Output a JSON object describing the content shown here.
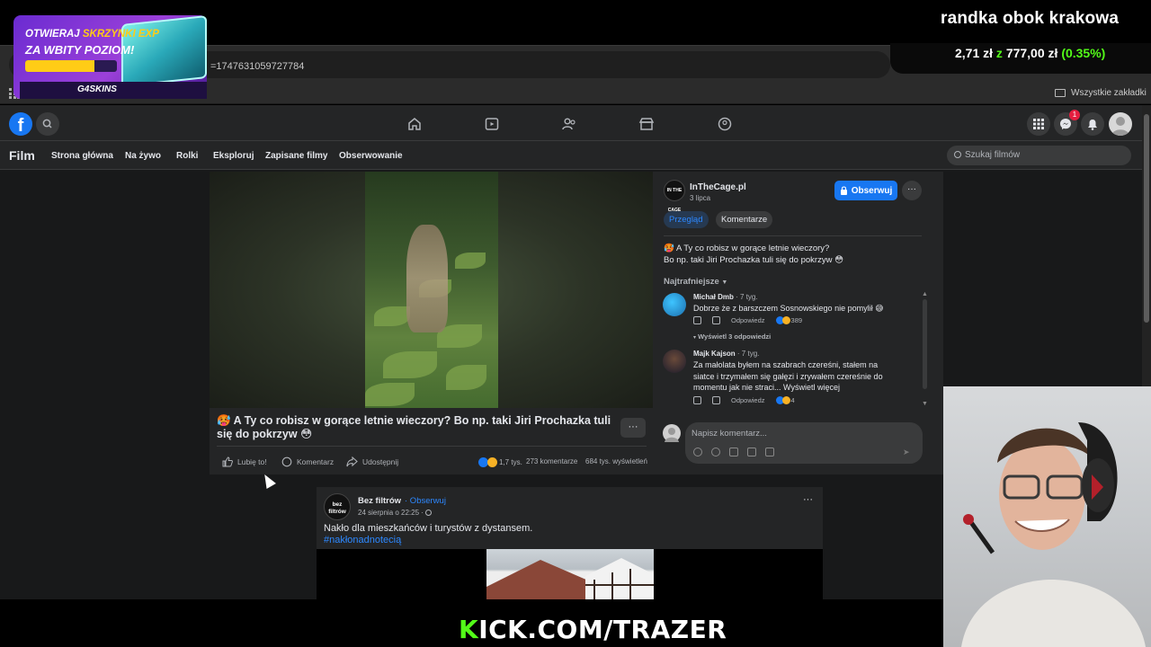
{
  "browser": {
    "address_fragment": "=1747631059727784",
    "bookmarks_label": "Wszystkie zakładki"
  },
  "fb_nav": {
    "logo": "f",
    "notifications_count": "1"
  },
  "film_nav": {
    "title": "Film",
    "items": [
      "Strona główna",
      "Na żywo",
      "Rolki",
      "Eksploruj",
      "Zapisane filmy",
      "Obserwowanie"
    ],
    "search_placeholder": "Szukaj filmów"
  },
  "video_post": {
    "caption": "🥵 A Ty co robisz w gorące letnie wieczory? Bo np. taki Jiri Prochazka tuli się do pokrzyw 😳",
    "more_label": "···",
    "actions": {
      "like": "Lubię to!",
      "comment": "Komentarz",
      "share": "Udostępnij"
    },
    "stats": {
      "reactions": "1,7 tys.",
      "comments": "273 komentarze",
      "views": "684 tys. wyświetleń"
    }
  },
  "panel": {
    "page_name": "InTheCage.pl",
    "page_logo_text": "IN THE CAGE",
    "date": "3 lipca",
    "follow_label": "Obserwuj",
    "more_label": "···",
    "tabs": [
      "Przegląd",
      "Komentarze"
    ],
    "description_line1": "🥵 A Ty co robisz w gorące letnie wieczory?",
    "description_line2": "Bo np. taki Jiri Prochazka tuli się do pokrzyw 😳",
    "sort_label": "Najtrafniejsze",
    "comments": [
      {
        "author": "Michał Dmb",
        "time": "· 7 tyg.",
        "text": "Dobrze że z barszczem Sosnowskiego nie pomylił 😅",
        "reply_label": "Odpowiedz",
        "reactions": "389",
        "view_replies": "Wyświetl 3 odpowiedzi"
      },
      {
        "author": "Majk Kajson",
        "time": "· 7 tyg.",
        "text": "Za małolata byłem na szabrach czereśni, stałem na siatce i trzymałem się gałęzi i zrywałem czereśnie do momentu jak nie straci... Wyświetl więcej",
        "reply_label": "Odpowiedz",
        "reactions": "4"
      }
    ],
    "comment_placeholder": "Napisz komentarz..."
  },
  "post2": {
    "page_name": "Bez filtrów",
    "page_logo_text": "bez filtrów",
    "follow_label": "· Obserwuj",
    "date": "24 sierpnia o 22:25 · ",
    "text": "Nakło dla mieszkańców i turystów z dystansem.",
    "hashtag": "#nakłonadnotecią",
    "more_label": "···"
  },
  "overlay": {
    "stream_title": "randka obok krakowa",
    "donation_current": "2,71 zł",
    "donation_of": "z",
    "donation_goal": "777,00 zł",
    "donation_percent": "(0.35%)",
    "promo_line1_a": "OTWIERAJ ",
    "promo_line1_b": "SKRZYNKI EXP",
    "promo_line2": "ZA WBITY POZIOM!",
    "promo_brand": "G4SKINS",
    "promo_progress": 0.75,
    "kick_k": "K",
    "kick_rest": "ICK.COM/TRAZER"
  },
  "colors": {
    "fb_blue": "#1877f2",
    "kick_green": "#53fc18",
    "promo_purple": "#9b40d9",
    "promo_yellow": "#ffcc16"
  },
  "icons": [
    "facebook-logo-icon",
    "search-icon",
    "home-icon",
    "video-icon",
    "friends-icon",
    "marketplace-icon",
    "groups-icon",
    "apps-grid-icon",
    "messenger-icon",
    "bell-icon",
    "lock-icon",
    "like-icon",
    "comment-icon",
    "share-icon",
    "folder-icon"
  ]
}
